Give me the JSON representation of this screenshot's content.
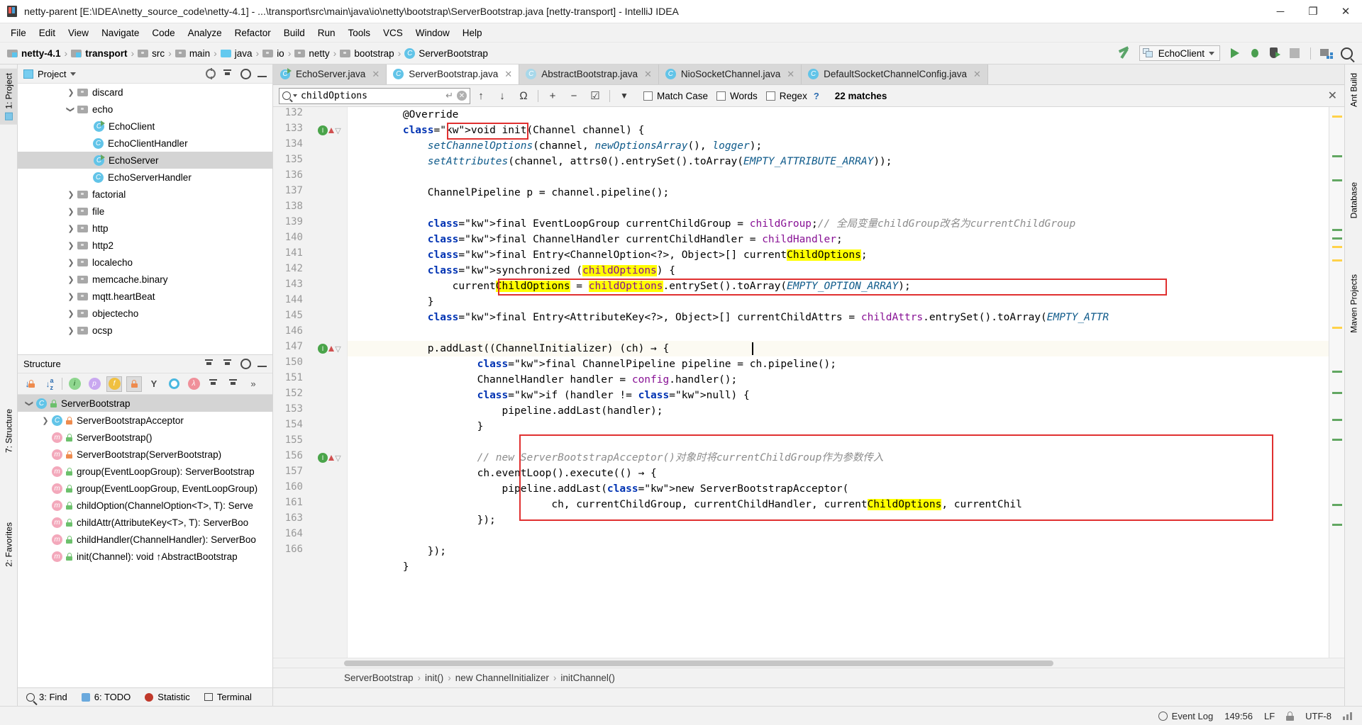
{
  "window": {
    "title": "netty-parent [E:\\IDEA\\netty_source_code\\netty-4.1] - ...\\transport\\src\\main\\java\\io\\netty\\bootstrap\\ServerBootstrap.java [netty-transport] - IntelliJ IDEA",
    "minimize": "─",
    "maximize": "❐",
    "close": "✕"
  },
  "menubar": {
    "items": [
      "File",
      "Edit",
      "View",
      "Navigate",
      "Code",
      "Analyze",
      "Refactor",
      "Build",
      "Run",
      "Tools",
      "VCS",
      "Window",
      "Help"
    ]
  },
  "navbar": {
    "crumbs": [
      {
        "label": "netty-4.1",
        "icon": "module-folder-icon",
        "bold": true
      },
      {
        "label": "transport",
        "icon": "module-folder-icon",
        "bold": true
      },
      {
        "label": "src",
        "icon": "folder-icon",
        "bold": false
      },
      {
        "label": "main",
        "icon": "folder-icon",
        "bold": false
      },
      {
        "label": "java",
        "icon": "source-folder-icon",
        "bold": false
      },
      {
        "label": "io",
        "icon": "package-icon",
        "bold": false
      },
      {
        "label": "netty",
        "icon": "package-icon",
        "bold": false
      },
      {
        "label": "bootstrap",
        "icon": "package-icon",
        "bold": false
      },
      {
        "label": "ServerBootstrap",
        "icon": "class-icon",
        "bold": false
      }
    ],
    "separator": "›",
    "run_config": "EchoClient",
    "toolbar_icons": [
      "build-hammer-icon",
      "run-icon",
      "debug-icon",
      "run-with-coverage-icon",
      "stop-icon",
      "project-structure-icon",
      "search-everywhere-icon"
    ]
  },
  "left_strips": {
    "top": [
      "1: Project"
    ],
    "bottom": [
      "7: Structure",
      "2: Favorites"
    ]
  },
  "right_strip": [
    "Ant Build",
    "Database",
    "Maven Projects"
  ],
  "project_panel": {
    "title": "Project",
    "dropdown": "▾",
    "actions": [
      "locate-icon",
      "collapse-all-icon",
      "settings-gear-icon",
      "hide-icon"
    ],
    "tree": [
      {
        "label": "discard",
        "type": "package",
        "indent": 3,
        "arrow": "right",
        "selected": false
      },
      {
        "label": "echo",
        "type": "package",
        "indent": 3,
        "arrow": "down",
        "selected": false
      },
      {
        "label": "EchoClient",
        "type": "class-runnable",
        "indent": 4,
        "arrow": "none",
        "selected": false
      },
      {
        "label": "EchoClientHandler",
        "type": "class",
        "indent": 4,
        "arrow": "none",
        "selected": false
      },
      {
        "label": "EchoServer",
        "type": "class-runnable",
        "indent": 4,
        "arrow": "none",
        "selected": true
      },
      {
        "label": "EchoServerHandler",
        "type": "class",
        "indent": 4,
        "arrow": "none",
        "selected": false
      },
      {
        "label": "factorial",
        "type": "package",
        "indent": 3,
        "arrow": "right",
        "selected": false
      },
      {
        "label": "file",
        "type": "package",
        "indent": 3,
        "arrow": "right",
        "selected": false
      },
      {
        "label": "http",
        "type": "package",
        "indent": 3,
        "arrow": "right",
        "selected": false
      },
      {
        "label": "http2",
        "type": "package",
        "indent": 3,
        "arrow": "right",
        "selected": false
      },
      {
        "label": "localecho",
        "type": "package",
        "indent": 3,
        "arrow": "right",
        "selected": false
      },
      {
        "label": "memcache.binary",
        "type": "package",
        "indent": 3,
        "arrow": "right",
        "selected": false
      },
      {
        "label": "mqtt.heartBeat",
        "type": "package",
        "indent": 3,
        "arrow": "right",
        "selected": false
      },
      {
        "label": "objectecho",
        "type": "package",
        "indent": 3,
        "arrow": "right",
        "selected": false
      },
      {
        "label": "ocsp",
        "type": "package",
        "indent": 3,
        "arrow": "right",
        "selected": false
      }
    ]
  },
  "structure_panel": {
    "title": "Structure",
    "actions": [
      "expand-all-icon",
      "collapse-all-icon"
    ],
    "toolbar": [
      {
        "name": "sort-by-visibility",
        "glyph": "↓"
      },
      {
        "name": "sort-alphabetically",
        "glyph": "↓"
      },
      {
        "name": "show-inherited",
        "glyph": "i"
      },
      {
        "name": "show-properties",
        "glyph": "p"
      },
      {
        "name": "show-fields",
        "glyph": "f"
      },
      {
        "name": "show-non-public",
        "glyph": "ὑ2"
      },
      {
        "name": "group-methods",
        "glyph": "Y"
      },
      {
        "name": "show-anonymous",
        "glyph": "O"
      },
      {
        "name": "show-lambdas",
        "glyph": "λ"
      },
      {
        "name": "expand-all",
        "glyph": "↧"
      },
      {
        "name": "collapse-all",
        "glyph": "↥"
      },
      {
        "name": "more",
        "glyph": "»"
      }
    ],
    "tree": [
      {
        "label": "ServerBootstrap",
        "kind": "c",
        "access": "public",
        "indent": 1,
        "arrow": "down",
        "selected": true
      },
      {
        "label": "ServerBootstrapAcceptor",
        "kind": "c-inner",
        "access": "private",
        "indent": 2,
        "arrow": "right",
        "selected": false
      },
      {
        "label": "ServerBootstrap()",
        "kind": "m",
        "access": "public",
        "indent": 2,
        "arrow": "none",
        "selected": false
      },
      {
        "label": "ServerBootstrap(ServerBootstrap)",
        "kind": "m",
        "access": "private",
        "indent": 2,
        "arrow": "none",
        "selected": false
      },
      {
        "label": "group(EventLoopGroup): ServerBootstrap",
        "kind": "m",
        "access": "public",
        "indent": 2,
        "arrow": "none",
        "selected": false
      },
      {
        "label": "group(EventLoopGroup, EventLoopGroup)",
        "kind": "m",
        "access": "public",
        "indent": 2,
        "arrow": "none",
        "selected": false
      },
      {
        "label": "childOption(ChannelOption<T>, T): Serve",
        "kind": "m",
        "access": "public",
        "indent": 2,
        "arrow": "none",
        "selected": false
      },
      {
        "label": "childAttr(AttributeKey<T>, T): ServerBoo",
        "kind": "m",
        "access": "public",
        "indent": 2,
        "arrow": "none",
        "selected": false
      },
      {
        "label": "childHandler(ChannelHandler): ServerBoo",
        "kind": "m",
        "access": "public",
        "indent": 2,
        "arrow": "none",
        "selected": false
      },
      {
        "label": "init(Channel): void ↑AbstractBootstrap",
        "kind": "m",
        "access": "public",
        "indent": 2,
        "arrow": "none",
        "selected": false
      }
    ]
  },
  "editor_tabs": [
    {
      "label": "EchoServer.java",
      "icon": "class-runnable-icon",
      "active": false,
      "close": "✕"
    },
    {
      "label": "ServerBootstrap.java",
      "icon": "class-icon",
      "active": true,
      "close": "✕"
    },
    {
      "label": "AbstractBootstrap.java",
      "icon": "abstract-class-icon",
      "active": false,
      "close": "✕"
    },
    {
      "label": "NioSocketChannel.java",
      "icon": "class-icon",
      "active": false,
      "close": "✕"
    },
    {
      "label": "DefaultSocketChannelConfig.java",
      "icon": "class-icon",
      "active": false,
      "close": "✕"
    }
  ],
  "find_bar": {
    "query": "childOptions",
    "icons": {
      "search": "search-icon",
      "dropdown": "chevron-down-icon",
      "enter": "↵",
      "clear": "✕"
    },
    "buttons": [
      {
        "name": "find-previous-button",
        "glyph": "↑"
      },
      {
        "name": "find-next-button",
        "glyph": "↓"
      },
      {
        "name": "select-all-occurrences-button",
        "glyph": "Ω"
      },
      {
        "name": "add-selection-button",
        "glyph": "+"
      },
      {
        "name": "remove-selection-button",
        "glyph": "−"
      },
      {
        "name": "select-all-button",
        "glyph": "☑"
      },
      {
        "name": "filter-button",
        "glyph": "▼"
      }
    ],
    "checkboxes": [
      {
        "label": "Match Case",
        "checked": false
      },
      {
        "label": "Words",
        "checked": false
      },
      {
        "label": "Regex",
        "checked": false
      }
    ],
    "help": "?",
    "matches": "22 matches",
    "close": "✕"
  },
  "code": {
    "first_visible_line": 132,
    "current_line": 147,
    "lines": [
      {
        "num": "132",
        "text": "        @Override",
        "kind": "annotation"
      },
      {
        "num": "133",
        "text": "        void init(Channel channel) {",
        "kind": "code"
      },
      {
        "num": "134",
        "text": "            setChannelOptions(channel, newOptionsArray(), logger);",
        "kind": "code"
      },
      {
        "num": "135",
        "text": "            setAttributes(channel, attrs0().entrySet().toArray(EMPTY_ATTRIBUTE_ARRAY));",
        "kind": "code"
      },
      {
        "num": "136",
        "text": "",
        "kind": "code"
      },
      {
        "num": "137",
        "text": "            ChannelPipeline p = channel.pipeline();",
        "kind": "code"
      },
      {
        "num": "138",
        "text": "",
        "kind": "code"
      },
      {
        "num": "139",
        "text": "            final EventLoopGroup currentChildGroup = childGroup;// 全局变量childGroup改名为currentChildGroup",
        "kind": "code"
      },
      {
        "num": "140",
        "text": "            final ChannelHandler currentChildHandler = childHandler;",
        "kind": "code"
      },
      {
        "num": "141",
        "text": "            final Entry<ChannelOption<?>, Object>[] currentChildOptions;",
        "kind": "code"
      },
      {
        "num": "142",
        "text": "            synchronized (childOptions) {",
        "kind": "code"
      },
      {
        "num": "143",
        "text": "                currentChildOptions = childOptions.entrySet().toArray(EMPTY_OPTION_ARRAY);",
        "kind": "code"
      },
      {
        "num": "144",
        "text": "            }",
        "kind": "code"
      },
      {
        "num": "145",
        "text": "            final Entry<AttributeKey<?>, Object>[] currentChildAttrs = childAttrs.entrySet().toArray(EMPTY_ATTR",
        "kind": "code"
      },
      {
        "num": "146",
        "text": "",
        "kind": "code"
      },
      {
        "num": "147",
        "text": "            p.addLast((ChannelInitializer) (ch) → {",
        "kind": "code"
      },
      {
        "num": "150",
        "text": "                    final ChannelPipeline pipeline = ch.pipeline();",
        "kind": "code"
      },
      {
        "num": "151",
        "text": "                    ChannelHandler handler = config.handler();",
        "kind": "code"
      },
      {
        "num": "152",
        "text": "                    if (handler != null) {",
        "kind": "code"
      },
      {
        "num": "153",
        "text": "                        pipeline.addLast(handler);",
        "kind": "code"
      },
      {
        "num": "154",
        "text": "                    }",
        "kind": "code"
      },
      {
        "num": "155",
        "text": "",
        "kind": "code"
      },
      {
        "num": "156",
        "text": "                    // new ServerBootstrapAcceptor()对象时将currentChildGroup作为参数传入",
        "kind": "code"
      },
      {
        "num": "157",
        "text": "                    ch.eventLoop().execute(() → {",
        "kind": "code"
      },
      {
        "num": "160",
        "text": "                        pipeline.addLast(new ServerBootstrapAcceptor(",
        "kind": "code"
      },
      {
        "num": "161",
        "text": "                                ch, currentChildGroup, currentChildHandler, currentChildOptions, currentChil",
        "kind": "code"
      },
      {
        "num": "163",
        "text": "                    });",
        "kind": "code"
      },
      {
        "num": "164",
        "text": "",
        "kind": "code"
      },
      {
        "num": "166",
        "text": "            });",
        "kind": "code"
      },
      {
        "num": "",
        "text": "        }",
        "kind": "code"
      }
    ],
    "highlight_term": "childOptions",
    "gutter_markers": [
      {
        "line": "133",
        "type": "override-marker"
      },
      {
        "line": "147",
        "type": "override-marker"
      },
      {
        "line": "157",
        "type": "override-marker"
      },
      {
        "line": "147",
        "type": "intention-bulb"
      }
    ]
  },
  "breadcrumbs": {
    "items": [
      "ServerBootstrap",
      "init()",
      "new ChannelInitializer",
      "initChannel()"
    ],
    "separator": "›"
  },
  "bottom_toolwindows": [
    {
      "label": "3: Find",
      "prefix": "",
      "icon": "find-icon"
    },
    {
      "label": "6: TODO",
      "prefix": "",
      "icon": "todo-icon"
    },
    {
      "label": "Statistic",
      "prefix": "",
      "icon": "statistic-icon"
    },
    {
      "label": "Terminal",
      "prefix": "",
      "icon": "terminal-icon"
    }
  ],
  "statusbar": {
    "caret": "149:56",
    "line_separator": "LF",
    "encoding": "UTF-8",
    "event_log": "Event Log",
    "readonly_icon": "lock-icon",
    "memory_icon": "memory-indicator"
  }
}
